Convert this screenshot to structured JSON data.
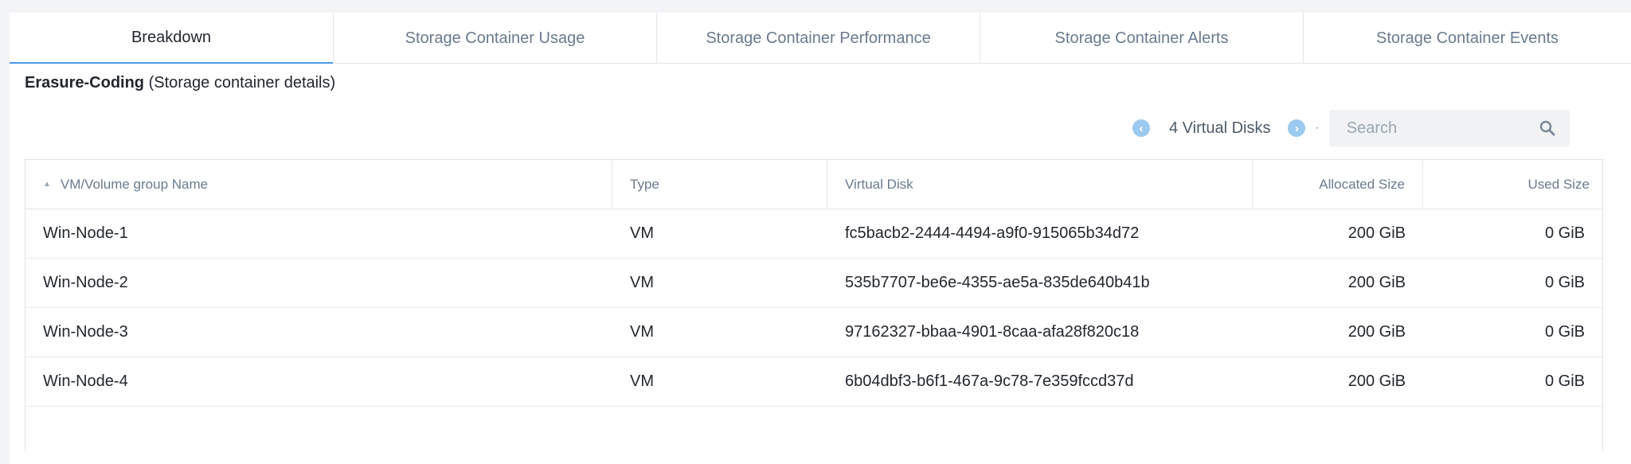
{
  "tabs": [
    {
      "label": "Breakdown",
      "active": true
    },
    {
      "label": "Storage Container Usage"
    },
    {
      "label": "Storage Container Performance"
    },
    {
      "label": "Storage Container Alerts"
    },
    {
      "label": "Storage Container Events"
    }
  ],
  "heading": {
    "name": "Erasure-Coding",
    "detail": "(Storage container details)"
  },
  "toolbar": {
    "count_label": "4 Virtual Disks",
    "prev_icon": "‹",
    "next_icon": "›",
    "separator": "·",
    "search_placeholder": "Search"
  },
  "table": {
    "columns": [
      "VM/Volume group Name",
      "Type",
      "Virtual Disk",
      "Allocated Size",
      "Used Size"
    ],
    "sort_indicator": "▲",
    "rows": [
      {
        "name": "Win-Node-1",
        "type": "VM",
        "disk": "fc5bacb2-2444-4494-a9f0-915065b34d72",
        "allocated": "200 GiB",
        "used": "0 GiB"
      },
      {
        "name": "Win-Node-2",
        "type": "VM",
        "disk": "535b7707-be6e-4355-ae5a-835de640b41b",
        "allocated": "200 GiB",
        "used": "0 GiB"
      },
      {
        "name": "Win-Node-3",
        "type": "VM",
        "disk": "97162327-bbaa-4901-8caa-afa28f820c18",
        "allocated": "200 GiB",
        "used": "0 GiB"
      },
      {
        "name": "Win-Node-4",
        "type": "VM",
        "disk": "6b04dbf3-b6f1-467a-9c78-7e359fccd37d",
        "allocated": "200 GiB",
        "used": "0 GiB"
      }
    ]
  },
  "colors": {
    "accent": "#4a98e6",
    "text": "#22272e",
    "muted": "#6a7a8e",
    "nav_circle": "#9cc9ef"
  }
}
